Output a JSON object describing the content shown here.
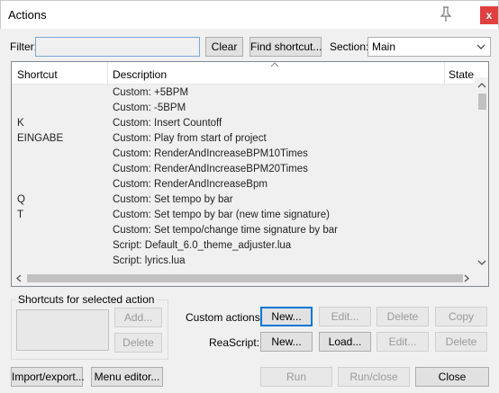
{
  "window": {
    "title": "Actions",
    "close_label": "x"
  },
  "filter": {
    "label": "Filter:",
    "value": "",
    "clear_label": "Clear",
    "find_shortcut_label": "Find shortcut..."
  },
  "section": {
    "label": "Section:",
    "selected": "Main"
  },
  "list": {
    "columns": [
      "Shortcut",
      "Description",
      "State"
    ],
    "rows": [
      {
        "shortcut": "",
        "description": "Custom: +5BPM"
      },
      {
        "shortcut": "",
        "description": "Custom: -5BPM"
      },
      {
        "shortcut": "K",
        "description": "Custom: Insert Countoff"
      },
      {
        "shortcut": "EINGABE",
        "description": "Custom: Play from start of project"
      },
      {
        "shortcut": "",
        "description": "Custom: RenderAndIncreaseBPM10Times"
      },
      {
        "shortcut": "",
        "description": "Custom: RenderAndIncreaseBPM20Times"
      },
      {
        "shortcut": "",
        "description": "Custom: RenderAndIncreaseBpm"
      },
      {
        "shortcut": "Q",
        "description": "Custom: Set tempo by bar"
      },
      {
        "shortcut": "T",
        "description": "Custom: Set tempo by bar (new time signature)"
      },
      {
        "shortcut": "",
        "description": "Custom: Set tempo/change time signature by bar"
      },
      {
        "shortcut": "",
        "description": "Script: Default_6.0_theme_adjuster.lua"
      },
      {
        "shortcut": "",
        "description": "Script: lyrics.lua"
      }
    ]
  },
  "shortcuts_group": {
    "legend": "Shortcuts for selected action",
    "add_label": "Add...",
    "delete_label": "Delete"
  },
  "custom_actions": {
    "label": "Custom actions:",
    "new_label": "New...",
    "edit_label": "Edit...",
    "delete_label": "Delete",
    "copy_label": "Copy"
  },
  "reascript": {
    "label": "ReaScript:",
    "new_label": "New...",
    "load_label": "Load...",
    "edit_label": "Edit...",
    "delete_label": "Delete"
  },
  "footer": {
    "import_export_label": "Import/export...",
    "menu_editor_label": "Menu editor...",
    "run_label": "Run",
    "run_close_label": "Run/close",
    "close_label": "Close"
  },
  "colors": {
    "close_button": "#e04040",
    "focus_accent": "#0078d7"
  }
}
